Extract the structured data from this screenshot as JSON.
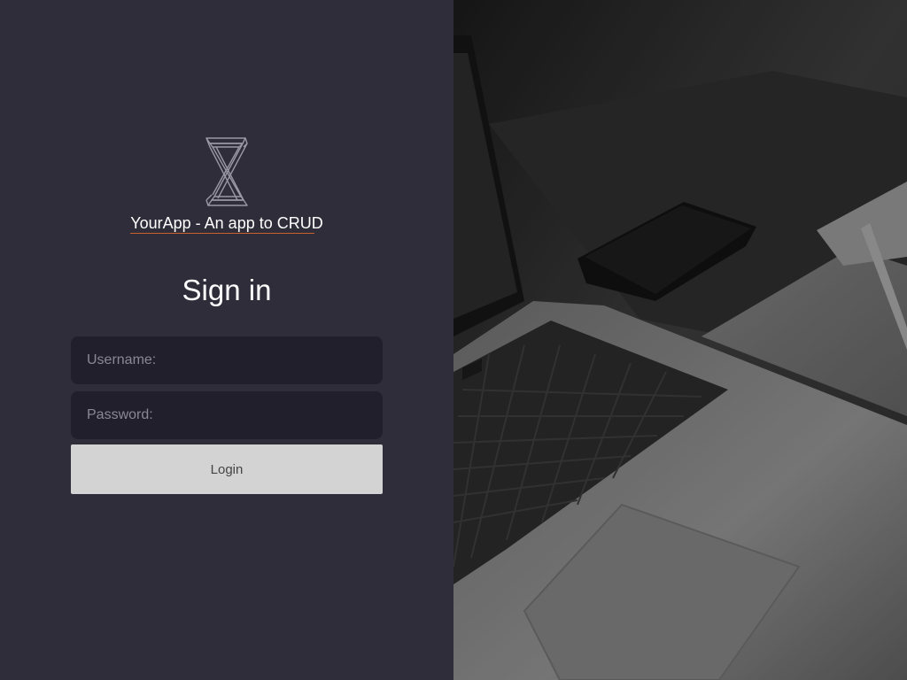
{
  "app": {
    "title": "YourApp - An app to CRUD",
    "accent_underline_color": "#c8622d",
    "logo_icon": "impossible-z-logo-icon"
  },
  "form": {
    "heading": "Sign in",
    "username_placeholder": "Username:",
    "password_placeholder": "Password:",
    "login_label": "Login"
  },
  "background": {
    "image_subject": "laptop-phone-notebook-photo"
  },
  "colors": {
    "left_panel": "#302d3a",
    "input_bg": "#211f2b",
    "button_bg": "#d3d3d3"
  }
}
